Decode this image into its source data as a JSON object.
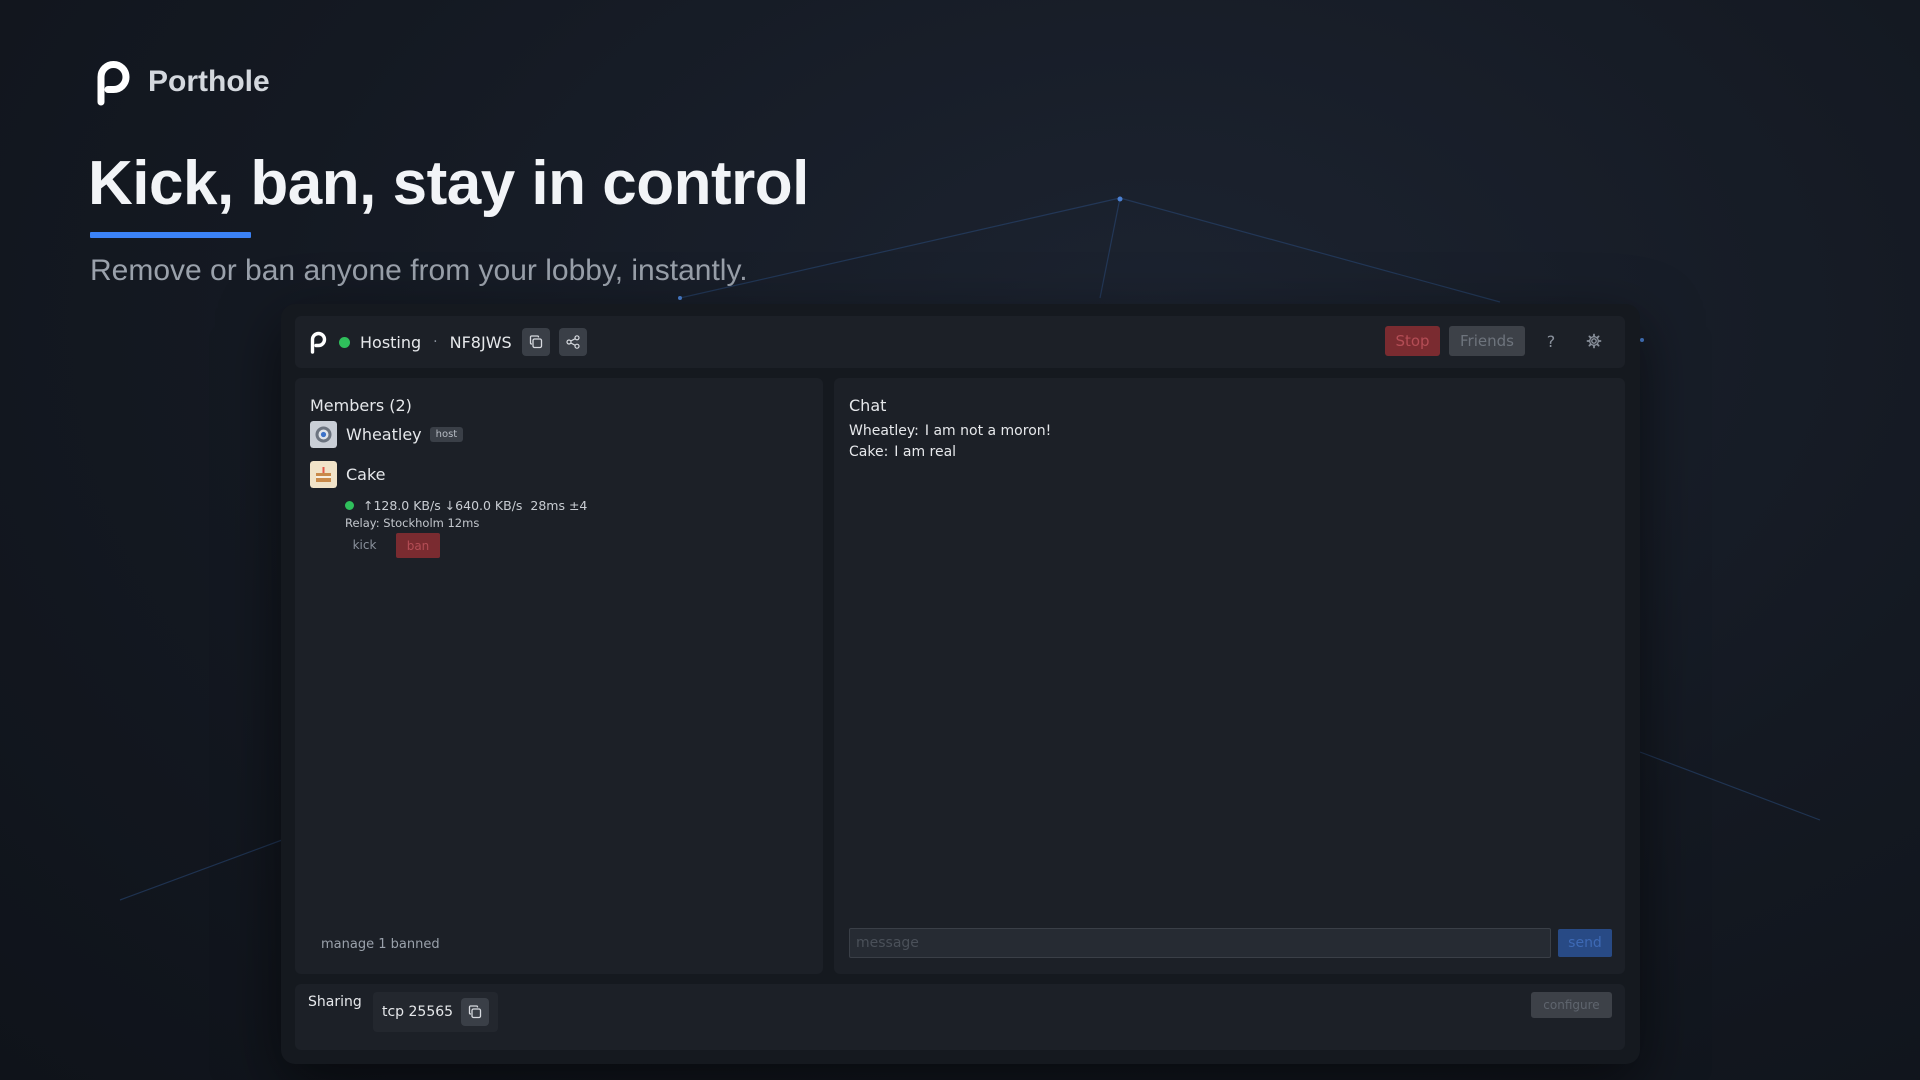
{
  "brand": {
    "name": "Porthole",
    "logo_icon": "porthole-p-logo"
  },
  "hero": {
    "headline": "Kick, ban, stay in control",
    "subheadline": "Remove or ban anyone from your lobby, instantly.",
    "accent_color": "#3b82f6"
  },
  "topbar": {
    "status": "Hosting",
    "separator": "·",
    "lobby_code": "NF8JWS",
    "copy_icon": "copy-icon",
    "share_icon": "share-icon",
    "stop_label": "Stop",
    "friends_label": "Friends",
    "help_label": "?",
    "settings_icon": "gear-icon",
    "status_color": "#2fbf5b"
  },
  "members": {
    "title": "Members (2)",
    "list": [
      {
        "name": "Wheatley",
        "badge": "host",
        "avatar_icon": "eye-orb-avatar"
      },
      {
        "name": "Cake",
        "avatar_icon": "cake-avatar",
        "stats": "↑128.0 KB/s ↓640.0 KB/s  28ms ±4",
        "relay": "Relay: Stockholm 12ms",
        "kick_label": "kick",
        "ban_label": "ban"
      }
    ],
    "manage_banned": "manage 1 banned"
  },
  "chat": {
    "title": "Chat",
    "messages": [
      {
        "sender": "Wheatley:",
        "text": "I am not a moron!"
      },
      {
        "sender": "Cake:",
        "text": "I am real"
      }
    ],
    "input_placeholder": "message",
    "send_label": "send"
  },
  "sharing": {
    "label": "Sharing",
    "entry": "tcp 25565",
    "configure_label": "configure"
  }
}
